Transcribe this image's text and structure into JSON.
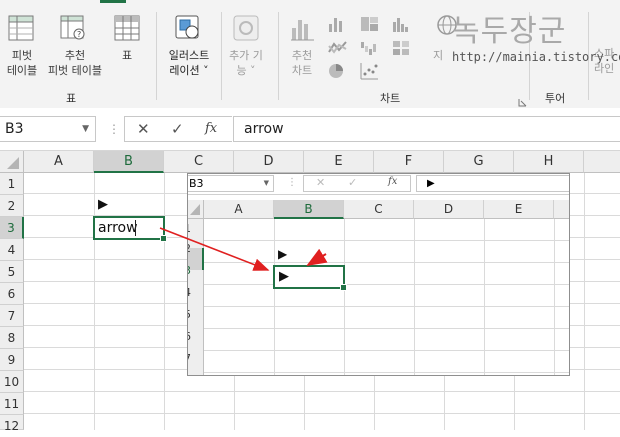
{
  "ribbon": {
    "pivot_table": [
      "피벗",
      "테이블"
    ],
    "recommended_pivot": [
      "추천",
      "피벗 테이블"
    ],
    "table": "표",
    "illustrations": [
      "일러스트",
      "레이션 ˅"
    ],
    "addins": [
      "추가 기",
      "능 ˅"
    ],
    "recommended_charts": [
      "추천",
      "차트"
    ],
    "group_table": "표",
    "group_charts": "차트",
    "group_tours": "투어",
    "tours_partial": "지",
    "sparklines_partial": [
      "스파",
      "라인"
    ]
  },
  "watermark": {
    "title": "녹두장군",
    "url": "http://mainia.tistory.com"
  },
  "formula_bar": {
    "name_box": "B3",
    "cancel_glyph": "✕",
    "enter_glyph": "✓",
    "fx_glyph": "fx",
    "content": "arrow"
  },
  "sheet": {
    "columns": [
      "A",
      "B",
      "C",
      "D",
      "E",
      "F",
      "G",
      "H"
    ],
    "rows": [
      "1",
      "2",
      "3",
      "4",
      "5",
      "6",
      "7",
      "8",
      "9",
      "10",
      "11",
      "12"
    ],
    "selected_column": "B",
    "selected_row": "3",
    "b2_glyph": "▶",
    "b3_text": "arrow"
  },
  "inset": {
    "name_box": "B3",
    "fx_glyph": "fx",
    "content_glyph": "▶",
    "columns": [
      "A",
      "B",
      "C",
      "D",
      "E"
    ],
    "rows": [
      "1",
      "2",
      "3",
      "4",
      "5",
      "6",
      "7"
    ],
    "selected_column": "B",
    "b2_glyph": "▶",
    "b3_glyph": "▶"
  },
  "colors": {
    "accent_green": "#217346",
    "arrow_red": "#e02020"
  },
  "icons": [
    "pivot-table-icon",
    "recommended-pivot-icon",
    "table-icon",
    "illustrations-icon",
    "addins-icon",
    "recommended-charts-icon",
    "bar-chart-icon",
    "hierarchy-chart-icon",
    "line-chart-icon",
    "statistic-chart-icon",
    "waterfall-chart-icon",
    "pie-chart-icon",
    "scatter-chart-icon",
    "map-chart-icon",
    "globe-icon",
    "dialog-launcher-icon",
    "dropdown-arrow-icon"
  ]
}
